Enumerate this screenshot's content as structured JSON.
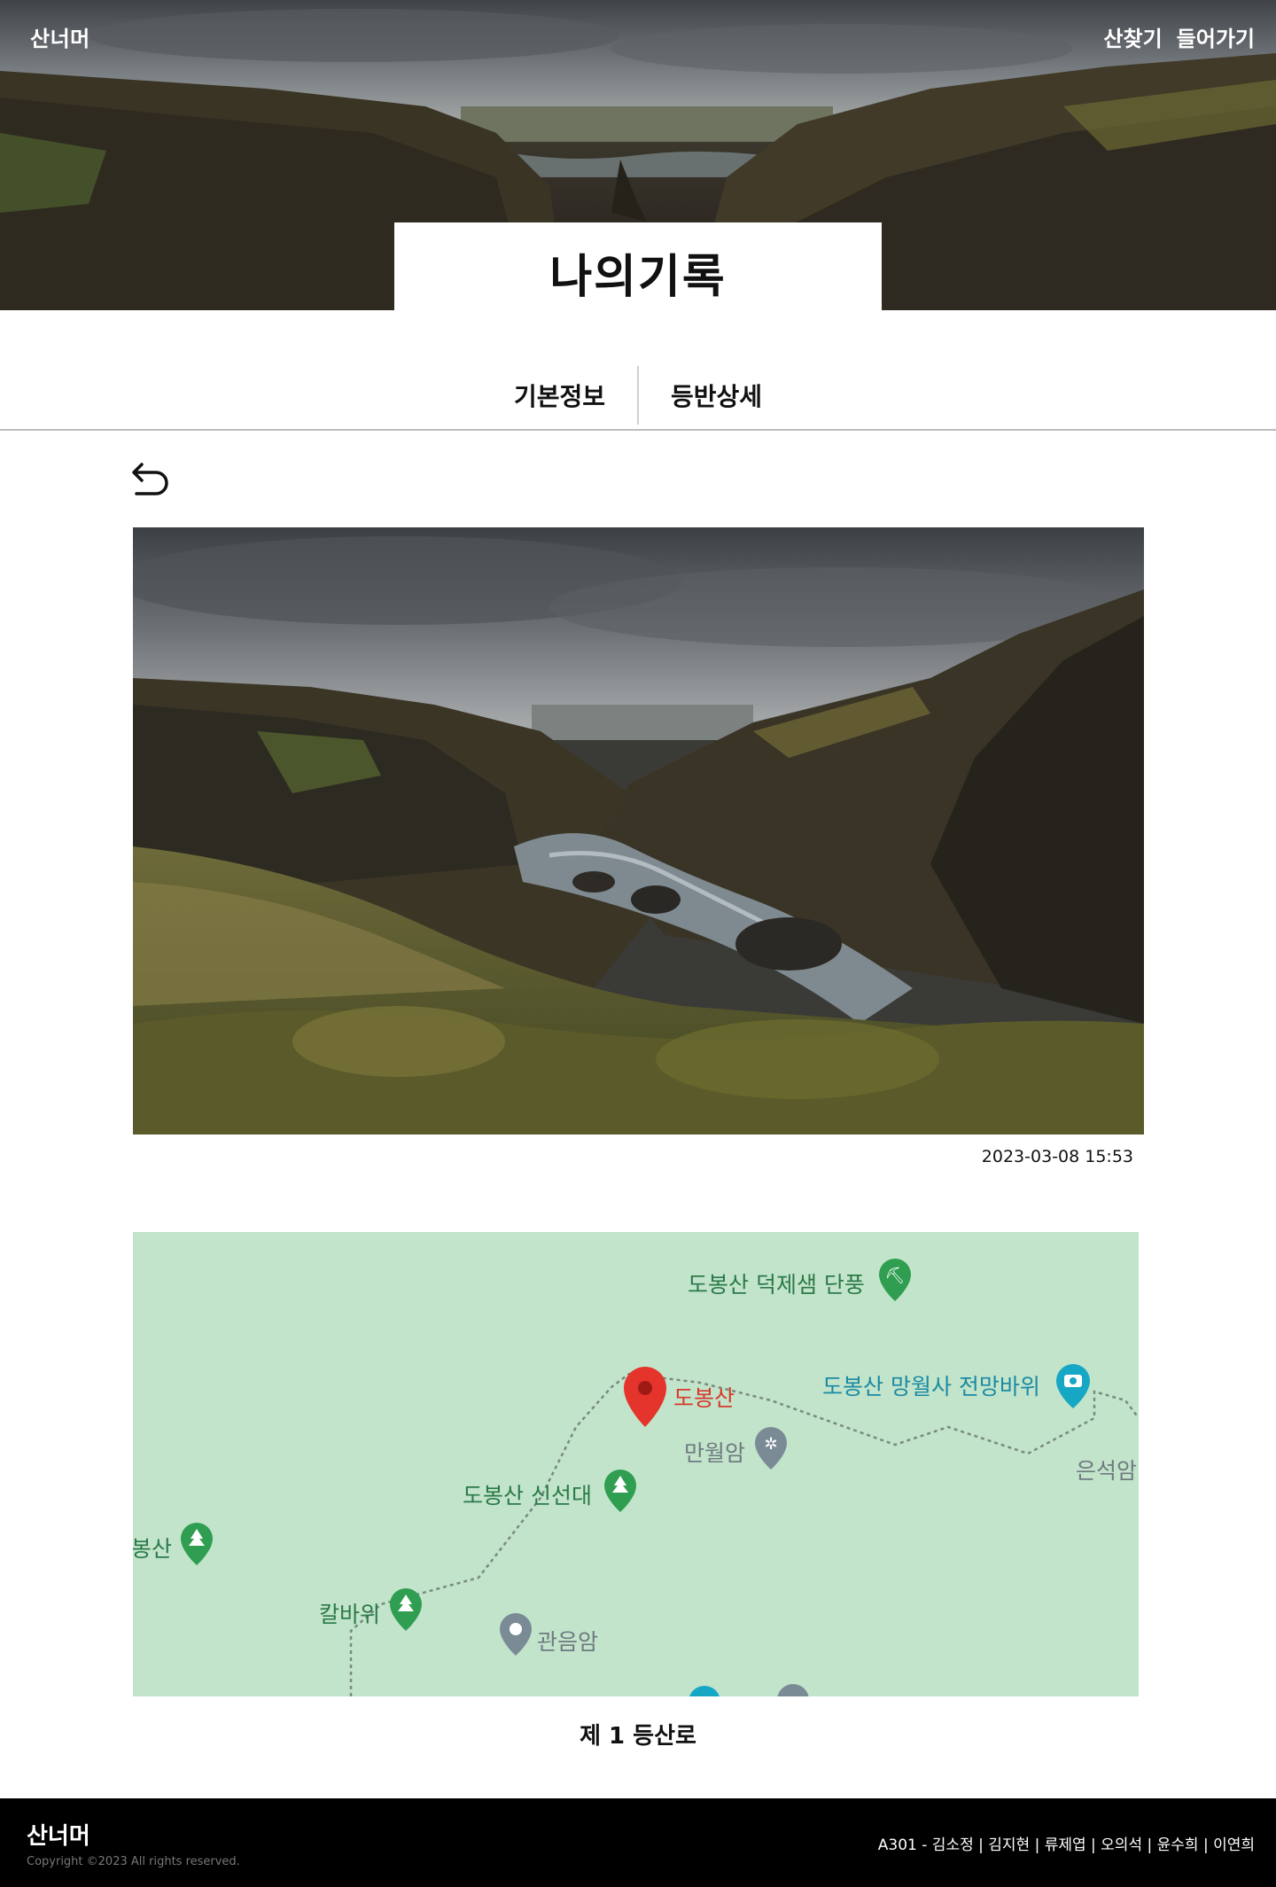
{
  "header": {
    "brand": "산너머",
    "nav": [
      "산찾기",
      "들어가기"
    ]
  },
  "page_title": "나의기록",
  "tabs": [
    "기본정보",
    "등반상세"
  ],
  "photo": {
    "timestamp": "2023-03-08 15:53"
  },
  "map": {
    "labels": {
      "ducheolsaem": "도봉산 덕제샘 단풍",
      "dobongsan": "도봉산",
      "mangwolsa": "도봉산 망월사 전망바위",
      "manwolam": "만월암",
      "eunseokam": "은석암",
      "sinseondae": "도봉산 신선대",
      "bongsan_left": "봉산",
      "kalbawi": "칼바위",
      "gwaneumam": "관음암"
    }
  },
  "route_name": "제 1 등산로",
  "footer": {
    "brand": "산너머",
    "copyright": "Copyright ©2023 All rights reserved.",
    "team": "A301 - 김소정 | 김지현 | 류제엽 | 오의석 | 윤수희 | 이연희"
  }
}
